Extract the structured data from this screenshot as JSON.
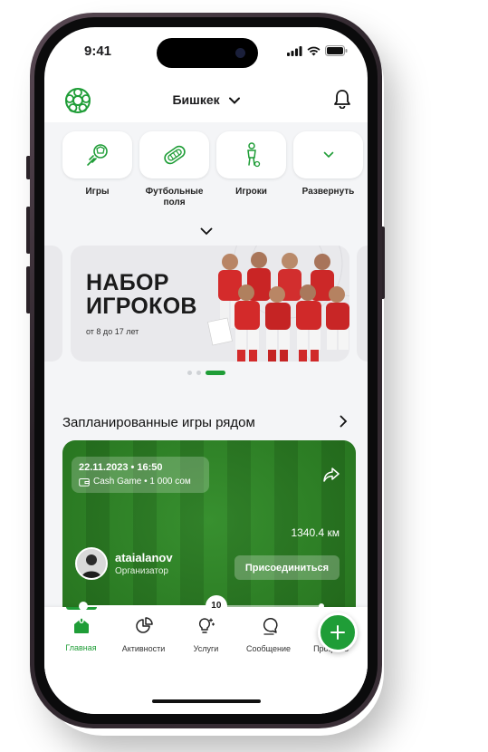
{
  "status_bar": {
    "time": "9:41"
  },
  "header": {
    "city": "Бишкек"
  },
  "categories": [
    {
      "label": "Игры",
      "icon": "football-kick-icon"
    },
    {
      "label": "Футбольные поля",
      "icon": "stadium-icon"
    },
    {
      "label": "Игроки",
      "icon": "player-icon"
    },
    {
      "label": "Развернуть",
      "icon": "chevron-down-icon"
    }
  ],
  "banner": {
    "title_line1": "НАБОР",
    "title_line2": "ИГРОКОВ",
    "subtitle": "от 8 до 17 лет"
  },
  "section": {
    "title": "Запланированные игры рядом"
  },
  "game_card": {
    "datetime": "22.11.2023 • 16:50",
    "game_info": "Cash Game • 1 000 сом",
    "distance": "1340.4 км",
    "organizer_name": "ataialanov",
    "organizer_role": "Организатор",
    "join_label": "Присоединиться",
    "slider_value": "10",
    "slider_min": "0",
    "slider_fraction": 0.56
  },
  "tabs": [
    {
      "label": "Главная",
      "icon": "home-icon",
      "active": true
    },
    {
      "label": "Активности",
      "icon": "pie-chart-icon",
      "active": false
    },
    {
      "label": "Услуги",
      "icon": "lightbulb-icon",
      "active": false
    },
    {
      "label": "Сообщение",
      "icon": "chat-icon",
      "active": false
    },
    {
      "label": "Профиль",
      "icon": "user-icon",
      "active": false
    }
  ],
  "colors": {
    "accent": "#1f9d37",
    "field_dark": "#267a1e",
    "field_light": "#2d8a24"
  }
}
